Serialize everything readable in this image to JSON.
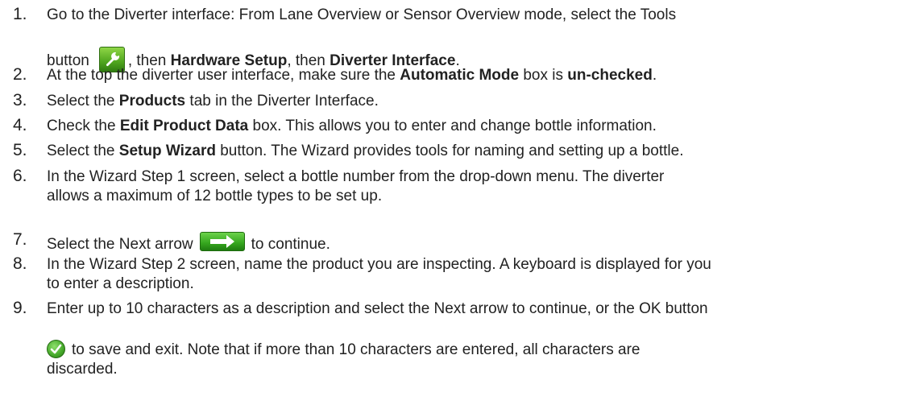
{
  "steps": [
    {
      "number": "1.",
      "line1": "Go to the Diverter interface: From Lane Overview or Sensor Overview mode, select the Tools",
      "l2_a": "button",
      "l2_b": ", then ",
      "l2_bold1": "Hardware Setup",
      "l2_c": ", then ",
      "l2_bold2": "Diverter Interface",
      "l2_d": "."
    },
    {
      "number": "2.",
      "a": "At the top the diverter user interface, make sure the ",
      "bold1": "Automatic Mode",
      "b": " box is ",
      "bold2": "un-checked",
      "c": "."
    },
    {
      "number": "3.",
      "a": "Select the ",
      "bold1": "Products",
      "b": " tab in the Diverter Interface."
    },
    {
      "number": "4.",
      "a": "Check the ",
      "bold1": "Edit Product Data",
      "b": " box. This allows you to enter and change bottle information."
    },
    {
      "number": "5.",
      "a": "Select the ",
      "bold1": "Setup Wizard",
      "b": " button. The Wizard provides tools for naming and setting up a bottle."
    },
    {
      "number": "6.",
      "line1": "In the Wizard Step 1 screen, select a bottle number from the drop-down menu. The diverter",
      "line2": "allows a maximum of 12 bottle types to be set up."
    },
    {
      "number": "7.",
      "a": "Select the Next arrow",
      "b": "to continue."
    },
    {
      "number": "8.",
      "line1": "In the Wizard Step 2 screen, name the product you are inspecting. A keyboard is displayed for you",
      "line2": "to enter a description."
    },
    {
      "number": "9.",
      "line1": "Enter up to 10 characters as a description and select the Next arrow to continue, or the OK button",
      "line2": "to save and exit. Note that if more than 10 characters are entered, all characters are",
      "line3": "discarded."
    }
  ],
  "icons": {
    "tools": "wrench-icon",
    "next": "arrow-right-icon",
    "ok": "checkmark-icon"
  },
  "colors": {
    "text": "#222222",
    "icon_green": "#45a82a"
  }
}
